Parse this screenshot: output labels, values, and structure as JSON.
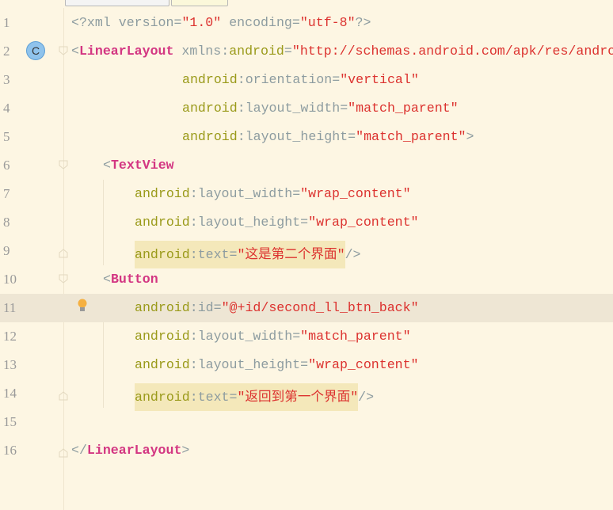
{
  "editor": {
    "lines": [
      {
        "n": "1",
        "indent": 0,
        "tokens": [
          [
            "pun",
            "<?"
          ],
          [
            "an",
            "xml version"
          ],
          [
            "pun",
            "="
          ],
          [
            "val",
            "\"1.0\""
          ],
          [
            "an",
            " encoding"
          ],
          [
            "pun",
            "="
          ],
          [
            "val",
            "\"utf-8\""
          ],
          [
            "pun",
            "?>"
          ]
        ]
      },
      {
        "n": "2",
        "indent": 0,
        "tokens": [
          [
            "pun",
            "<"
          ],
          [
            "tag",
            "LinearLayout"
          ],
          [
            "an",
            " xmlns"
          ],
          [
            "pun",
            ":"
          ],
          [
            "ns",
            "android"
          ],
          [
            "pun",
            "="
          ],
          [
            "val",
            "\"http://schemas.android.com/apk/res/android\""
          ]
        ]
      },
      {
        "n": "3",
        "indent": 14,
        "tokens": [
          [
            "ns",
            "android"
          ],
          [
            "pun",
            ":"
          ],
          [
            "an",
            "orientation"
          ],
          [
            "pun",
            "="
          ],
          [
            "val",
            "\"vertical\""
          ]
        ]
      },
      {
        "n": "4",
        "indent": 14,
        "tokens": [
          [
            "ns",
            "android"
          ],
          [
            "pun",
            ":"
          ],
          [
            "an",
            "layout_width"
          ],
          [
            "pun",
            "="
          ],
          [
            "val",
            "\"match_parent\""
          ]
        ]
      },
      {
        "n": "5",
        "indent": 14,
        "tokens": [
          [
            "ns",
            "android"
          ],
          [
            "pun",
            ":"
          ],
          [
            "an",
            "layout_height"
          ],
          [
            "pun",
            "="
          ],
          [
            "val",
            "\"match_parent\""
          ],
          [
            "pun",
            ">"
          ]
        ]
      },
      {
        "n": "6",
        "indent": 4,
        "tokens": [
          [
            "pun",
            "<"
          ],
          [
            "tag",
            "TextView"
          ]
        ]
      },
      {
        "n": "7",
        "indent": 8,
        "tokens": [
          [
            "ns",
            "android"
          ],
          [
            "pun",
            ":"
          ],
          [
            "an",
            "layout_width"
          ],
          [
            "pun",
            "="
          ],
          [
            "val",
            "\"wrap_content\""
          ]
        ]
      },
      {
        "n": "8",
        "indent": 8,
        "tokens": [
          [
            "ns",
            "android"
          ],
          [
            "pun",
            ":"
          ],
          [
            "an",
            "layout_height"
          ],
          [
            "pun",
            "="
          ],
          [
            "val",
            "\"wrap_content\""
          ]
        ]
      },
      {
        "n": "9",
        "indent": 8,
        "hl": true,
        "tokens": [
          [
            "ns",
            "android"
          ],
          [
            "pun",
            ":"
          ],
          [
            "an",
            "text"
          ],
          [
            "pun",
            "="
          ],
          [
            "val",
            "\"这是第二个界面\""
          ]
        ],
        "tail": [
          [
            "pun",
            "/>"
          ]
        ]
      },
      {
        "n": "10",
        "indent": 4,
        "tokens": [
          [
            "pun",
            "<"
          ],
          [
            "tag",
            "Button"
          ]
        ]
      },
      {
        "n": "11",
        "indent": 8,
        "current": true,
        "tokens": [
          [
            "ns",
            "android"
          ],
          [
            "pun",
            ":"
          ],
          [
            "an",
            "id"
          ],
          [
            "pun",
            "="
          ],
          [
            "val",
            "\"@+id/second_ll_btn_back\""
          ]
        ]
      },
      {
        "n": "12",
        "indent": 8,
        "tokens": [
          [
            "ns",
            "android"
          ],
          [
            "pun",
            ":"
          ],
          [
            "an",
            "layout_width"
          ],
          [
            "pun",
            "="
          ],
          [
            "val",
            "\"match_parent\""
          ]
        ]
      },
      {
        "n": "13",
        "indent": 8,
        "tokens": [
          [
            "ns",
            "android"
          ],
          [
            "pun",
            ":"
          ],
          [
            "an",
            "layout_height"
          ],
          [
            "pun",
            "="
          ],
          [
            "val",
            "\"wrap_content\""
          ]
        ]
      },
      {
        "n": "14",
        "indent": 8,
        "hl": true,
        "tokens": [
          [
            "ns",
            "android"
          ],
          [
            "pun",
            ":"
          ],
          [
            "an",
            "text"
          ],
          [
            "pun",
            "="
          ],
          [
            "val",
            "\"返回到第一个界面\""
          ]
        ],
        "tail": [
          [
            "pun",
            "/>"
          ]
        ]
      },
      {
        "n": "15",
        "indent": 0,
        "tokens": []
      },
      {
        "n": "16",
        "indent": 0,
        "tokens": [
          [
            "pun",
            "</"
          ],
          [
            "tag",
            "LinearLayout"
          ],
          [
            "pun",
            ">"
          ]
        ]
      }
    ],
    "class_marker": "C"
  }
}
